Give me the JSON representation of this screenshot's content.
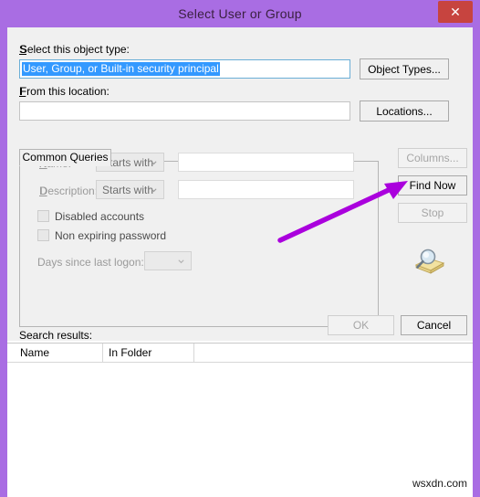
{
  "window": {
    "title": "Select User or Group",
    "close_label": "✕",
    "titlebar_color": "#a96de3",
    "close_button_color": "#c7443f",
    "frame_color": "#a96de3"
  },
  "object_type": {
    "label": "Select this object type:",
    "label_accel": "S",
    "value": "User, Group, or Built-in security principal",
    "selected": true,
    "button_label": "Object Types...",
    "button_accel": "O"
  },
  "location": {
    "label": "From this location:",
    "label_accel": "F",
    "value": "",
    "button_label": "Locations...",
    "button_accel": "L"
  },
  "tab": {
    "label": "Common Queries",
    "active": true
  },
  "query": {
    "name": {
      "label": "Name:",
      "label_accel": "a",
      "condition": "Starts with",
      "value": "",
      "disabled": true
    },
    "description": {
      "label": "Description:",
      "label_accel": "D",
      "condition": "Starts with",
      "value": "",
      "disabled": true
    },
    "disabled_accounts": {
      "label": "Disabled accounts",
      "label_accel": "b",
      "checked": false,
      "disabled": true
    },
    "non_expiring_password": {
      "label": "Non expiring password",
      "label_accel": "x",
      "checked": false,
      "disabled": true
    },
    "days_since_logon": {
      "label": "Days since last logon:",
      "label_accel": "i",
      "value": "",
      "disabled": true
    }
  },
  "side_buttons": {
    "columns": {
      "label": "Columns...",
      "accel": "C",
      "disabled": true
    },
    "find_now": {
      "label": "Find Now",
      "accel": "N",
      "disabled": false
    },
    "stop": {
      "label": "Stop",
      "accel": "t",
      "disabled": true
    }
  },
  "icons": {
    "search_folder": "search-folder-icon",
    "close": "close-icon",
    "chevron": "chevron-down-icon"
  },
  "footer_buttons": {
    "ok": {
      "label": "OK",
      "disabled": true
    },
    "cancel": {
      "label": "Cancel",
      "disabled": false
    }
  },
  "results": {
    "label": "Search results:",
    "label_accel": "u",
    "columns": [
      "Name",
      "In Folder"
    ],
    "rows": []
  },
  "annotation": {
    "arrow_color": "#aa00dd",
    "points_at": "Find Now"
  },
  "watermark": {
    "text": "wsxdn.com"
  }
}
